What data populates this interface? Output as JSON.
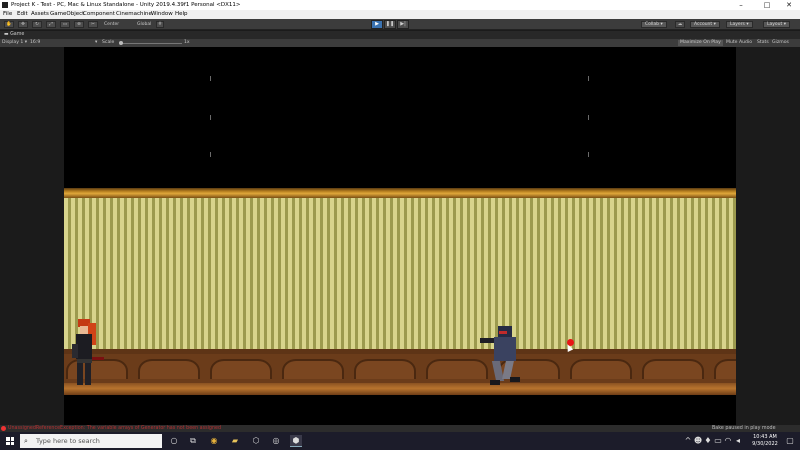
{
  "window": {
    "title": "Project K - Test - PC, Mac & Linux Standalone - Unity 2019.4.39f1 Personal <DX11>",
    "minimize_glyph": "–",
    "maximize_glyph": "□",
    "close_glyph": "✕"
  },
  "menu": {
    "items": [
      "File",
      "Edit",
      "Assets",
      "GameObject",
      "Component",
      "Cinemachine",
      "Window",
      "Help"
    ]
  },
  "toolbar": {
    "pivot_label": "Center",
    "space_label": "Global",
    "collab_label": "Collab",
    "account_label": "Account",
    "layers_label": "Layers",
    "layout_label": "Layout",
    "play_active": true,
    "accent_color": "#3a72b0"
  },
  "game_view": {
    "tab_label": "Game",
    "display_label": "Display 1",
    "aspect_label": "16:9",
    "scale_label": "Scale",
    "scale_value": "1x",
    "maximize_label": "Maximize On Play",
    "mute_label": "Mute Audio",
    "stats_label": "Stats",
    "gizmos_label": "Gizmos"
  },
  "status": {
    "error_text": "UnassignedReferenceException: The variable arrays of Generator has not been assigned",
    "bake_text": "Bake paused in play mode",
    "error_color": "#b43030"
  },
  "taskbar": {
    "search_placeholder": "Type here to search",
    "time": "10:43 AM",
    "date": "9/30/2022"
  }
}
